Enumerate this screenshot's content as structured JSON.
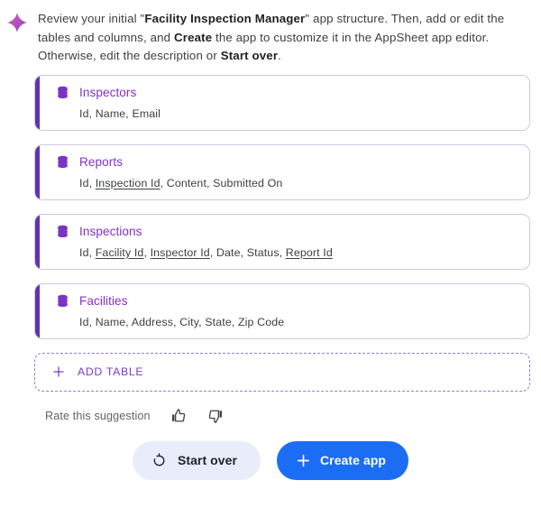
{
  "header": {
    "sparkle_icon": "sparkle-icon",
    "description_parts": [
      {
        "text": "Review your initial \"",
        "bold": false
      },
      {
        "text": "Facility Inspection Manager",
        "bold": true
      },
      {
        "text": "\" app structure. Then, add or edit the tables and columns, and ",
        "bold": false
      },
      {
        "text": "Create",
        "bold": true
      },
      {
        "text": " the app to customize it in the AppSheet app editor. Otherwise, edit the description or ",
        "bold": false
      },
      {
        "text": "Start over",
        "bold": true
      },
      {
        "text": ".",
        "bold": false
      }
    ],
    "description_plain": "Review your initial \"Facility Inspection Manager\" app structure. Then, add or edit the tables and columns, and Create the app to customize it in the AppSheet app editor. Otherwise, edit the description or Start over."
  },
  "app_name": "Facility Inspection Manager",
  "tables": [
    {
      "name": "Inspectors",
      "icon": "database-icon",
      "columns_text": "Id, Name, Email",
      "columns": [
        {
          "label": "Id",
          "reference": false
        },
        {
          "label": "Name",
          "reference": false
        },
        {
          "label": "Email",
          "reference": false
        }
      ]
    },
    {
      "name": "Reports",
      "icon": "database-icon",
      "columns_text": "Id, Inspection Id, Content, Submitted On",
      "columns": [
        {
          "label": "Id",
          "reference": false
        },
        {
          "label": "Inspection Id",
          "reference": true
        },
        {
          "label": "Content",
          "reference": false
        },
        {
          "label": "Submitted On",
          "reference": false
        }
      ]
    },
    {
      "name": "Inspections",
      "icon": "database-icon",
      "columns_text": "Id, Facility Id, Inspector Id, Date, Status, Report Id",
      "columns": [
        {
          "label": "Id",
          "reference": false
        },
        {
          "label": "Facility Id",
          "reference": true
        },
        {
          "label": "Inspector Id",
          "reference": true
        },
        {
          "label": "Date",
          "reference": false
        },
        {
          "label": "Status",
          "reference": false
        },
        {
          "label": "Report Id",
          "reference": true
        }
      ]
    },
    {
      "name": "Facilities",
      "icon": "database-icon",
      "columns_text": "Id, Name, Address, City, State, Zip Code",
      "columns": [
        {
          "label": "Id",
          "reference": false
        },
        {
          "label": "Name",
          "reference": false
        },
        {
          "label": "Address",
          "reference": false
        },
        {
          "label": "City",
          "reference": false
        },
        {
          "label": "State",
          "reference": false
        },
        {
          "label": "Zip Code",
          "reference": false
        }
      ]
    }
  ],
  "add_table": {
    "label": "ADD TABLE",
    "icon": "plus-icon"
  },
  "feedback": {
    "label": "Rate this suggestion",
    "thumb_up_icon": "thumb-up-icon",
    "thumb_down_icon": "thumb-down-icon"
  },
  "footer": {
    "start_over": {
      "label": "Start over",
      "icon": "restore-icon"
    },
    "create_app": {
      "label": "Create app",
      "icon": "plus-icon"
    }
  },
  "colors": {
    "accent_purple": "#6234ab",
    "title_purple": "#8430ce",
    "add_table_purple": "#7e3bc4",
    "card_border": "#cfc8e4",
    "primary_blue": "#1b6ef3",
    "secondary_bg": "#e9edfa",
    "body_text": "#3c4043",
    "muted_text": "#5f6368"
  }
}
